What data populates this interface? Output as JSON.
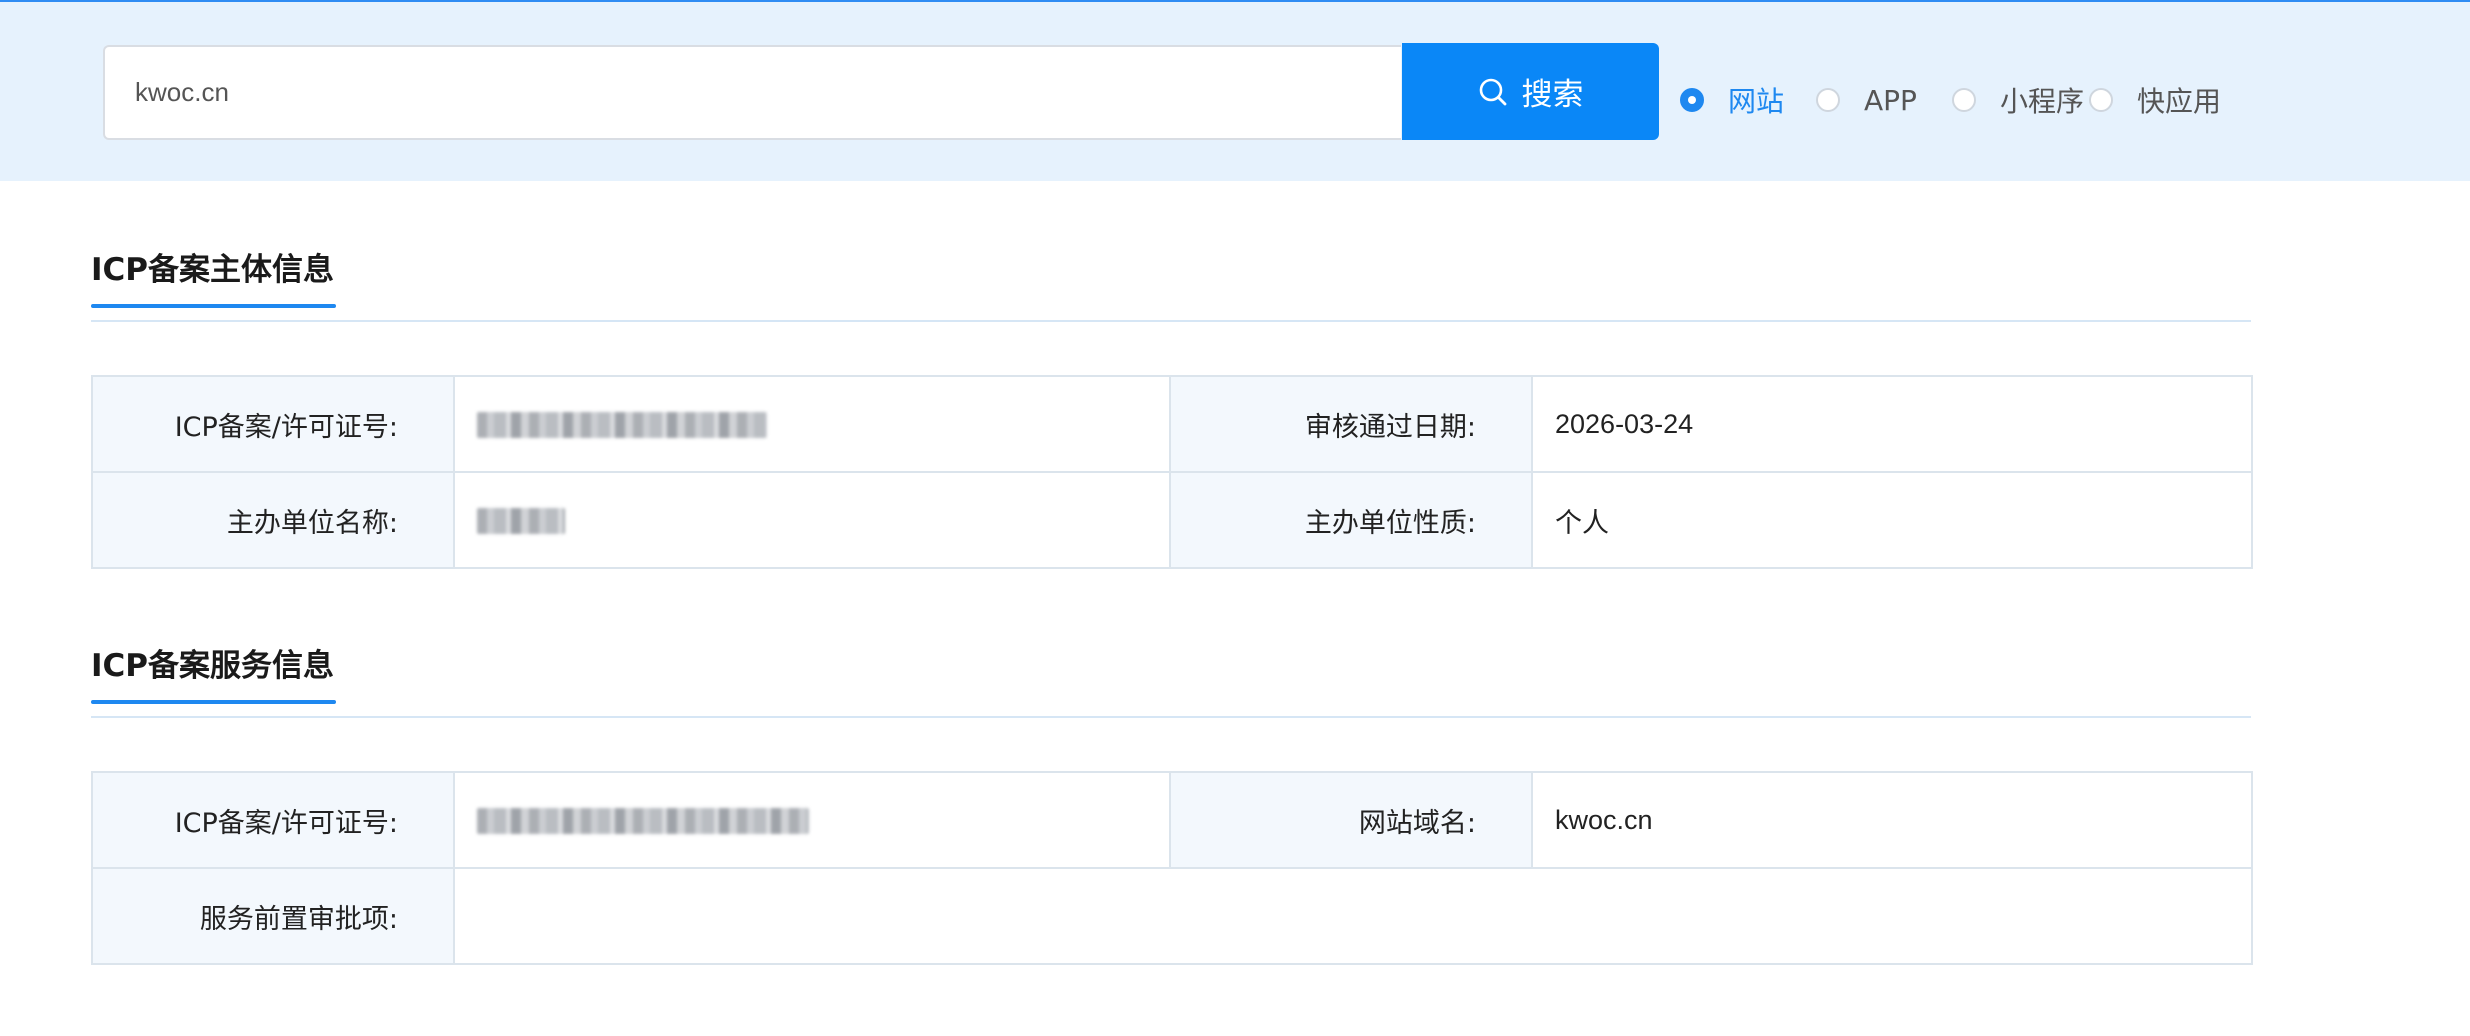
{
  "search": {
    "value": "kwoc.cn",
    "button_label": "搜索"
  },
  "query_types": [
    {
      "label": "网站",
      "checked": true
    },
    {
      "label": "APP",
      "checked": false
    },
    {
      "label": "小程序",
      "checked": false
    },
    {
      "label": "快应用",
      "checked": false
    }
  ],
  "entity_section": {
    "title": "ICP备案主体信息",
    "rows": [
      {
        "label1": "ICP备案/许可证号:",
        "value1": "",
        "label2": "审核通过日期:",
        "value2": "2026-03-24"
      },
      {
        "label1": "主办单位名称:",
        "value1": "",
        "label2": "主办单位性质:",
        "value2": "个人"
      }
    ]
  },
  "service_section": {
    "title": "ICP备案服务信息",
    "rows": [
      {
        "label1": "ICP备案/许可证号:",
        "value1": "",
        "label2": "网站域名:",
        "value2": "kwoc.cn"
      },
      {
        "label1": "服务前置审批项:",
        "value1": ""
      }
    ]
  },
  "colors": {
    "accent": "#1e88f0",
    "button": "#0a87f7",
    "search_band": "#e6f2fd",
    "label_cell": "#f3f8fd"
  },
  "icons": {
    "search_button": "search-icon"
  }
}
